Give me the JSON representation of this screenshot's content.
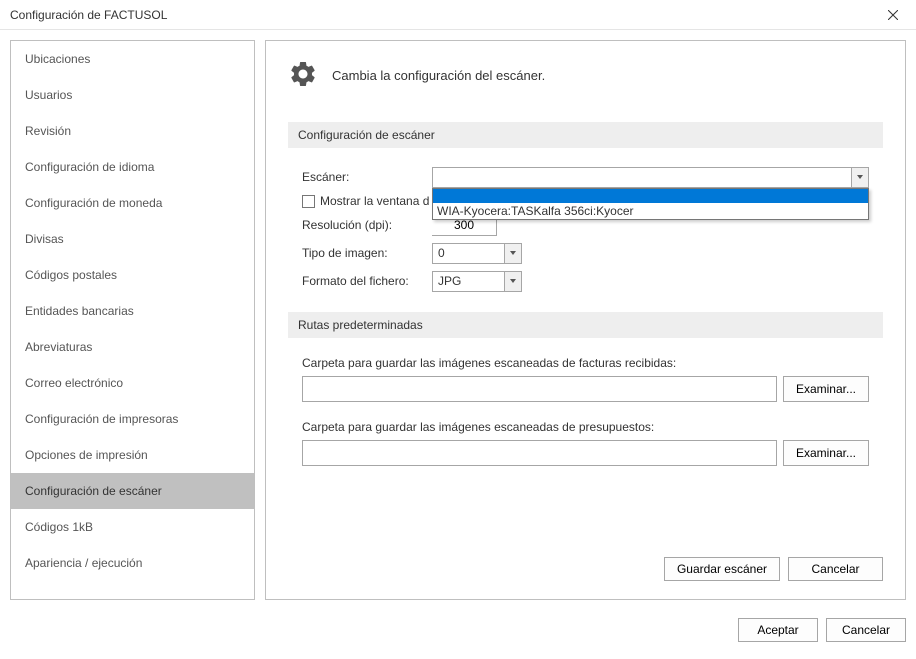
{
  "titlebar": {
    "title": "Configuración de FACTUSOL"
  },
  "sidebar": {
    "items": [
      {
        "label": "Ubicaciones"
      },
      {
        "label": "Usuarios"
      },
      {
        "label": "Revisión"
      },
      {
        "label": "Configuración de idioma"
      },
      {
        "label": "Configuración de moneda"
      },
      {
        "label": "Divisas"
      },
      {
        "label": "Códigos postales"
      },
      {
        "label": "Entidades bancarias"
      },
      {
        "label": "Abreviaturas"
      },
      {
        "label": "Correo electrónico"
      },
      {
        "label": "Configuración de impresoras"
      },
      {
        "label": "Opciones de impresión"
      },
      {
        "label": "Configuración de escáner"
      },
      {
        "label": "Códigos 1kB"
      },
      {
        "label": "Apariencia / ejecución"
      }
    ],
    "selected_index": 12
  },
  "content": {
    "header": "Cambia la configuración del escáner.",
    "section1_title": "Configuración de escáner",
    "scanner_label": "Escáner:",
    "scanner_value": "",
    "dropdown_option_blank": " ",
    "dropdown_option_1": "WIA-Kyocera:TASKalfa 356ci:Kyocer",
    "show_window_label": "Mostrar la ventana d",
    "resolution_label": "Resolución (dpi):",
    "resolution_value": "300",
    "image_type_label": "Tipo de imagen:",
    "image_type_value": "0",
    "file_format_label": "Formato del fichero:",
    "file_format_value": "JPG",
    "section2_title": "Rutas predeterminadas",
    "path1_label": "Carpeta para guardar las imágenes escaneadas de facturas recibidas:",
    "path1_value": "",
    "path2_label": "Carpeta para guardar las imágenes escaneadas de presupuestos:",
    "path2_value": "",
    "examine_label": "Examinar...",
    "save_label": "Guardar escáner",
    "cancel_label": "Cancelar"
  },
  "dialog_footer": {
    "accept_label": "Aceptar",
    "cancel_label": "Cancelar"
  }
}
